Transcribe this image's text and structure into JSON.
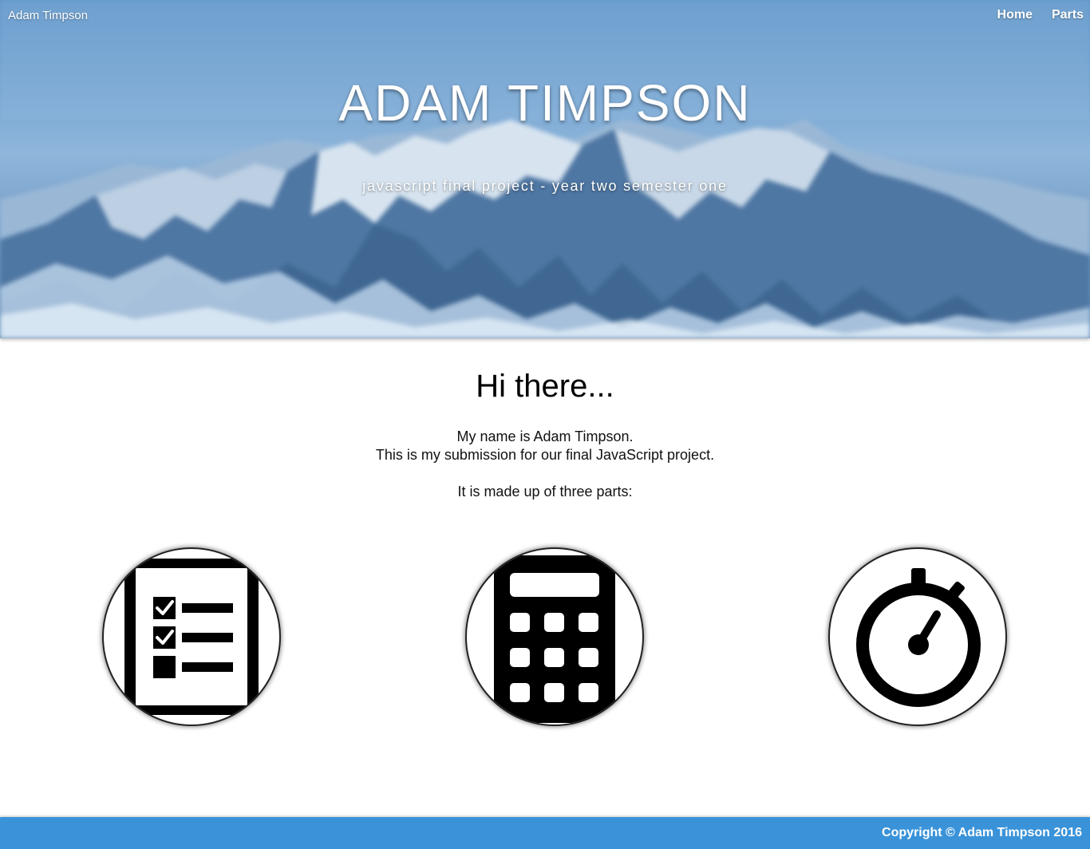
{
  "nav": {
    "brand": "Adam Timpson",
    "links": [
      {
        "label": "Home"
      },
      {
        "label": "Parts"
      }
    ]
  },
  "hero": {
    "title": "ADAM TIMPSON",
    "subtitle": "javascript final project - year two semester one"
  },
  "content": {
    "heading": "Hi there...",
    "lines": [
      "My name is Adam Timpson.",
      "This is my submission for our final JavaScript project.",
      "It is made up of three parts:"
    ]
  },
  "parts": [
    {
      "icon": "checklist-icon"
    },
    {
      "icon": "calculator-icon"
    },
    {
      "icon": "stopwatch-icon"
    }
  ],
  "colors": {
    "footer": "#3a93d9",
    "hero_sky": "#7aa8d3"
  },
  "footer": {
    "copyright": "Copyright © Adam Timpson 2016"
  }
}
